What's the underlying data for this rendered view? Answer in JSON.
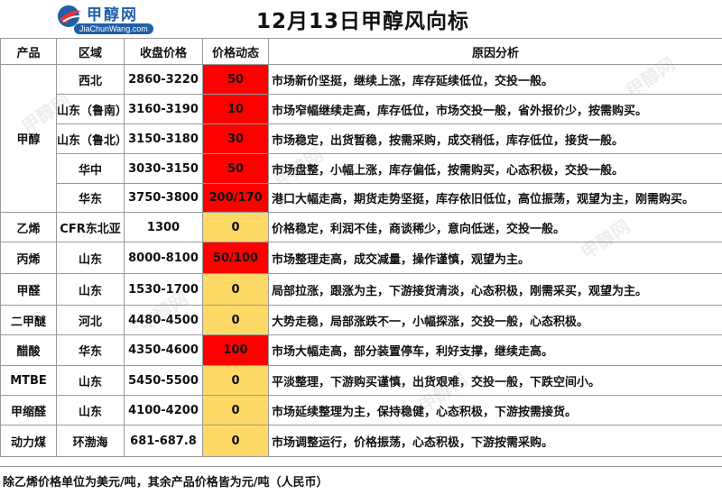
{
  "header": {
    "logo_brand": "甲醇网",
    "logo_site": "JiaChunWang.com",
    "title": "12月13日甲醇风向标"
  },
  "columns": [
    "产品",
    "区域",
    "收盘价格",
    "价格动态",
    "原因分析"
  ],
  "groups": [
    {
      "product": "甲醇",
      "rows": [
        {
          "region": "西北",
          "price": "2860-3220",
          "change": "50",
          "change_color": "#ff0000",
          "reason": "市场新价坚挺，继续上涨，库存延续低位，交投一般。"
        },
        {
          "region": "山东（鲁南）",
          "price": "3160-3190",
          "change": "10",
          "change_color": "#ff0000",
          "reason": "市场窄幅继续走高，库存低位，市场交投一般，省外报价少，按需购买。"
        },
        {
          "region": "山东（鲁北）",
          "price": "3150-3180",
          "change": "30",
          "change_color": "#ff0000",
          "reason": "市场稳定，出货暂稳，按需采购，成交稍低，库存低位，接货一般。"
        },
        {
          "region": "华中",
          "price": "3030-3150",
          "change": "50",
          "change_color": "#ff0000",
          "reason": "市场盘整，小幅上涨，库存偏低，按需购买，心态积极，交投一般。"
        },
        {
          "region": "华东",
          "price": "3750-3800",
          "change": "200/170",
          "change_color": "#ff0000",
          "reason": "港口大幅走高，期货走势坚挺，库存依旧低位，高位振荡，观望为主，刚需购买。"
        }
      ]
    },
    {
      "product": "乙烯",
      "rows": [
        {
          "region": "CFR东北亚",
          "price": "1300",
          "change": "0",
          "change_color": "#ffd966",
          "reason": "价格稳定，利润不佳，商谈稀少，意向低迷，交投一般。"
        }
      ]
    },
    {
      "product": "丙烯",
      "rows": [
        {
          "region": "山东",
          "price": "8000-8100",
          "change": "50/100",
          "change_color": "#ff0000",
          "reason": "市场整理走高，成交减量，操作谨慎，观望为主。"
        }
      ]
    },
    {
      "product": "甲醛",
      "rows": [
        {
          "region": "山东",
          "price": "1530-1700",
          "change": "0",
          "change_color": "#ffd966",
          "reason": "局部拉涨，跟涨为主，下游接货清淡，心态积极，刚需采买，观望为主。"
        }
      ]
    },
    {
      "product": "二甲醚",
      "rows": [
        {
          "region": "河北",
          "price": "4480-4500",
          "change": "0",
          "change_color": "#ffd966",
          "reason": "大势走稳，局部涨跌不一，小幅探涨，交投一般，心态积极。"
        }
      ]
    },
    {
      "product": "醋酸",
      "rows": [
        {
          "region": "华东",
          "price": "4350-4600",
          "change": "100",
          "change_color": "#ff0000",
          "reason": "市场大幅走高，部分装置停车，利好支撑，继续走高。"
        }
      ]
    },
    {
      "product": "MTBE",
      "rows": [
        {
          "region": "山东",
          "price": "5450-5500",
          "change": "0",
          "change_color": "#ffd966",
          "reason": "平淡整理，下游购买谨慎，出货艰难，交投一般，下跌空间小。"
        }
      ]
    },
    {
      "product": "甲缩醛",
      "rows": [
        {
          "region": "山东",
          "price": "4100-4200",
          "change": "0",
          "change_color": "#ffd966",
          "reason": "市场延续整理为主，保持稳健，心态积极，下游按需接货。"
        }
      ]
    },
    {
      "product": "动力煤",
      "rows": [
        {
          "region": "环渤海",
          "price": "681-687.8",
          "change": "0",
          "change_color": "#ffd966",
          "reason": "市场调整运行，价格振荡，心态积极，下游按需采购。"
        }
      ]
    }
  ],
  "footer": "除乙烯价格单位为美元/吨，其余产品价格皆为元/吨（人民币）"
}
